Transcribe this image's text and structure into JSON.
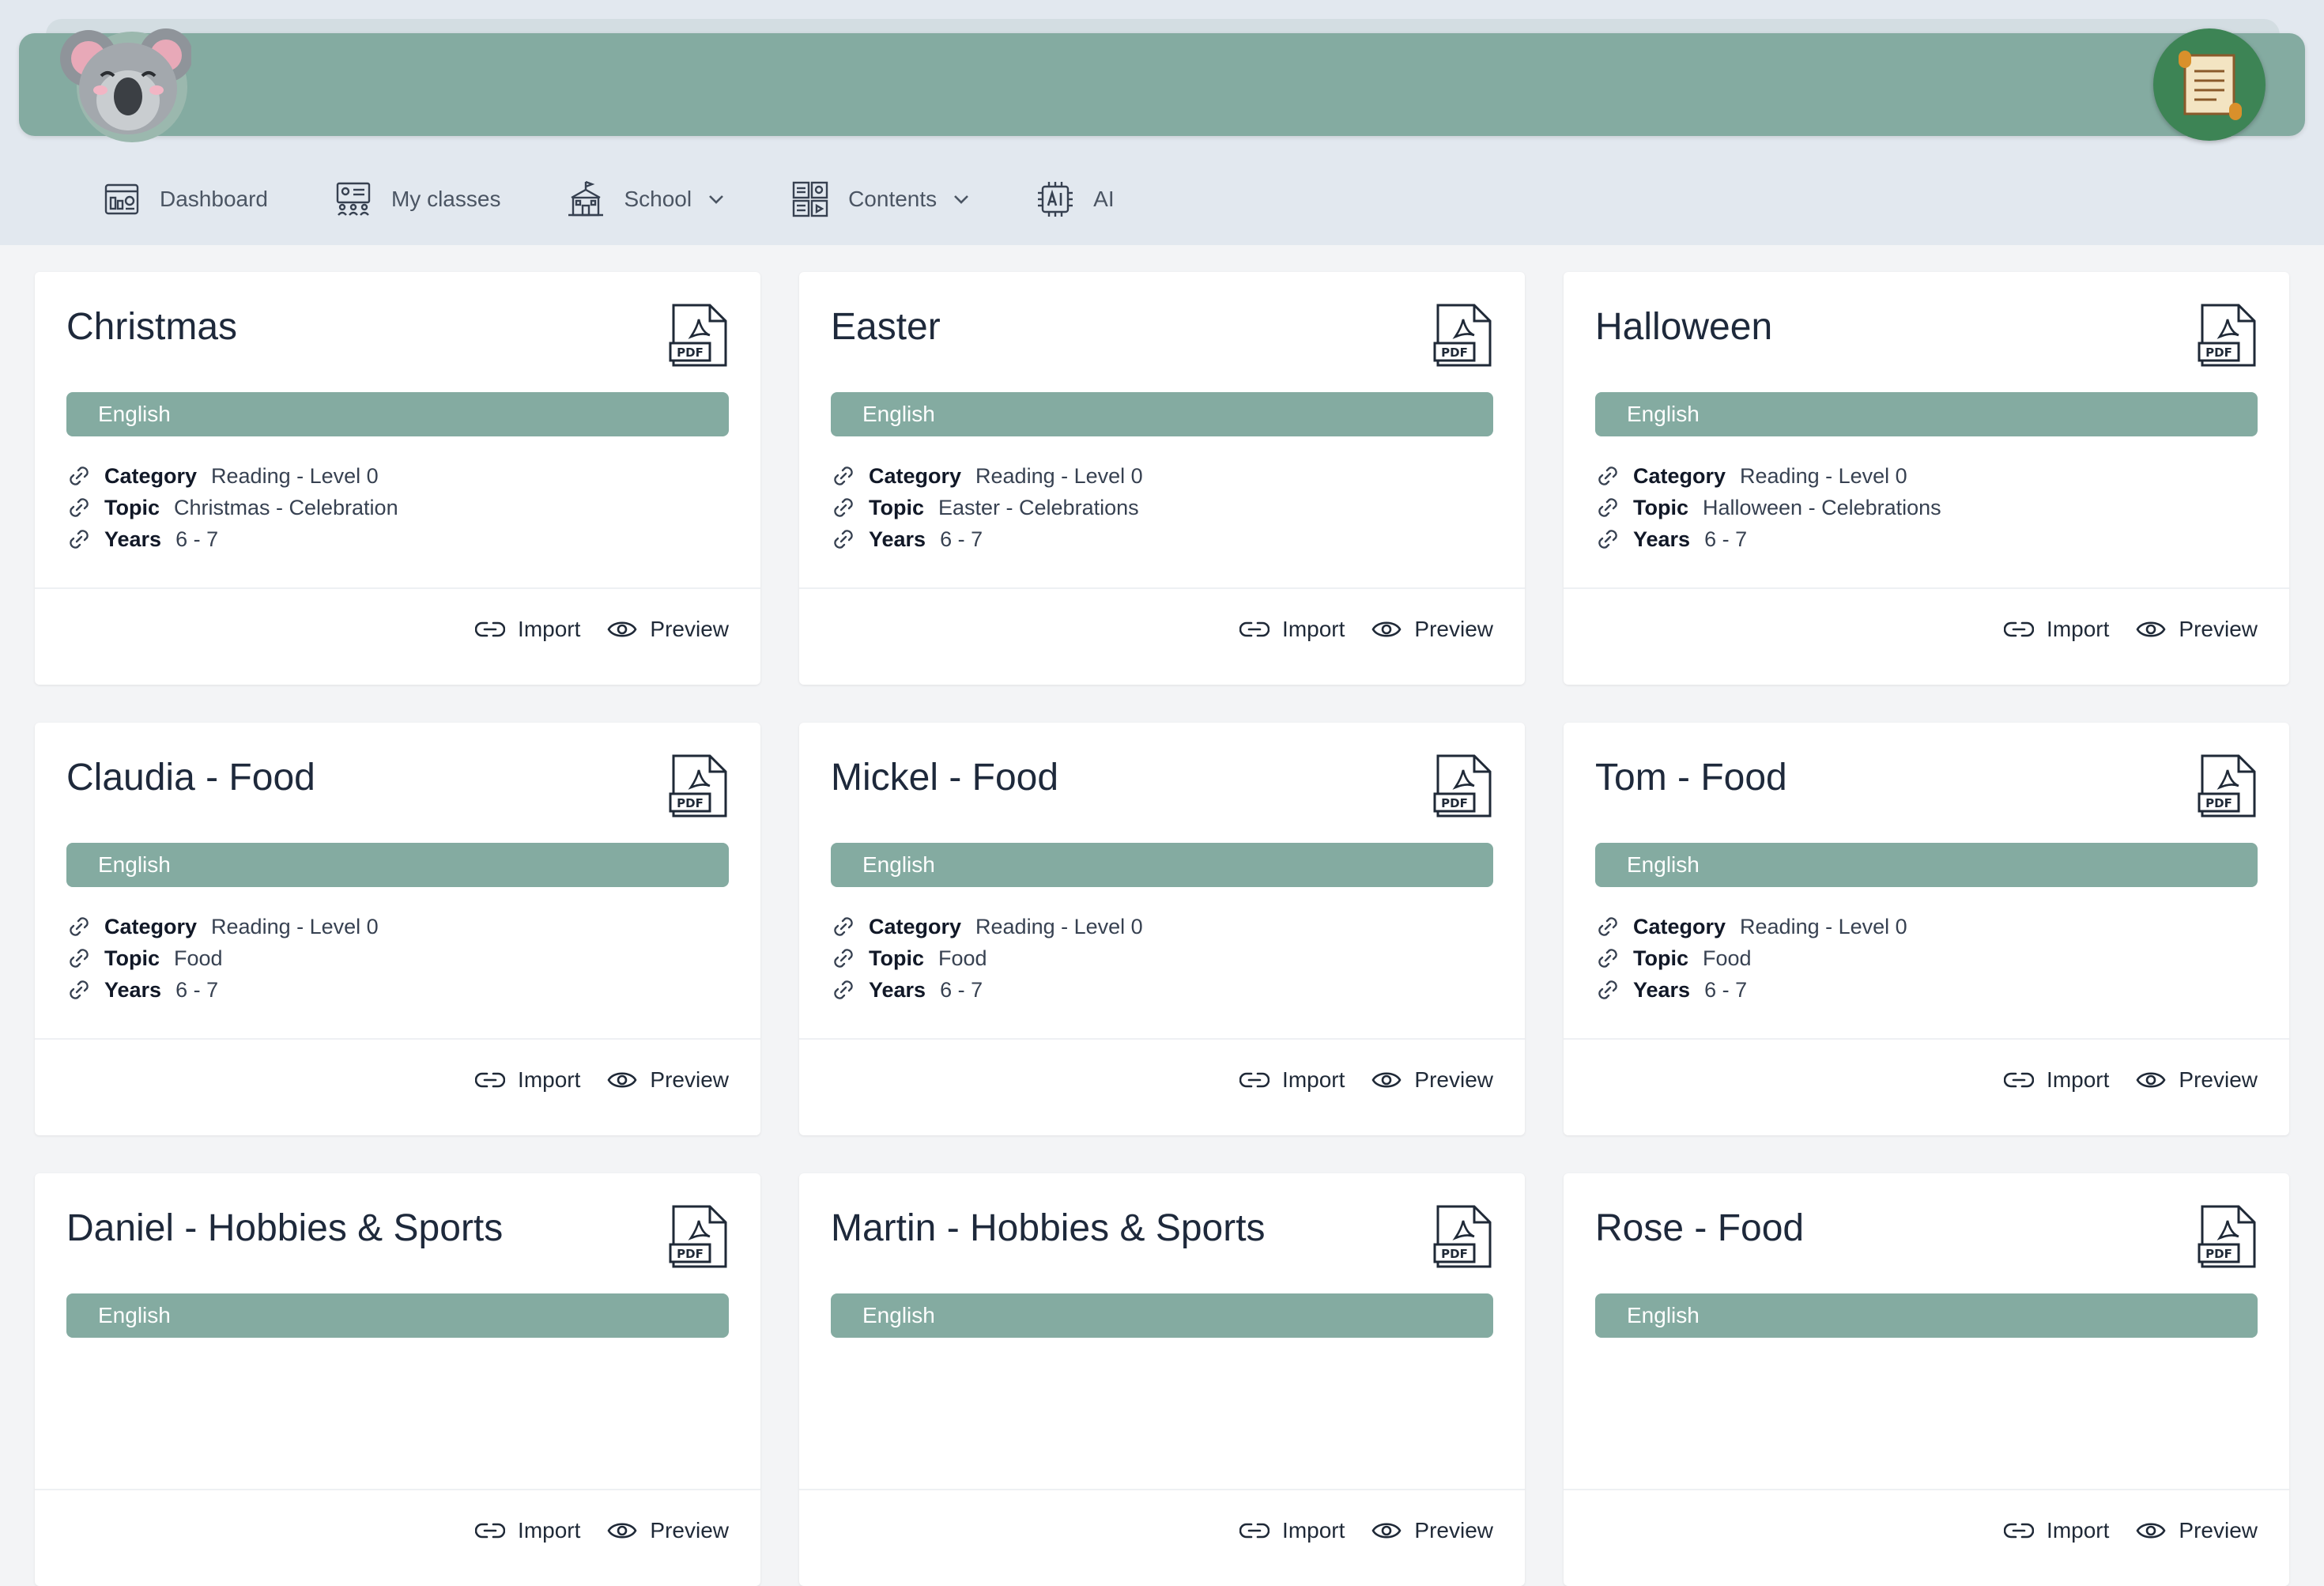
{
  "nav": {
    "items": [
      {
        "label": "Dashboard",
        "icon": "dashboard-icon",
        "dropdown": false
      },
      {
        "label": "My classes",
        "icon": "classroom-icon",
        "dropdown": false
      },
      {
        "label": "School",
        "icon": "school-icon",
        "dropdown": true
      },
      {
        "label": "Contents",
        "icon": "contents-icon",
        "dropdown": true
      },
      {
        "label": "AI",
        "icon": "ai-chip-icon",
        "dropdown": false
      }
    ]
  },
  "colors": {
    "accent": "#84aba1",
    "scroll_button": "#3d8455"
  },
  "labels": {
    "category": "Category",
    "topic": "Topic",
    "years": "Years",
    "import": "Import",
    "preview": "Preview"
  },
  "cards": [
    {
      "title": "Christmas",
      "language": "English",
      "category": "Reading - Level 0",
      "topic": "Christmas - Celebration",
      "years": "6 - 7"
    },
    {
      "title": "Easter",
      "language": "English",
      "category": "Reading - Level 0",
      "topic": "Easter - Celebrations",
      "years": "6 - 7"
    },
    {
      "title": "Halloween",
      "language": "English",
      "category": "Reading - Level 0",
      "topic": "Halloween - Celebrations",
      "years": "6 - 7"
    },
    {
      "title": "Claudia - Food",
      "language": "English",
      "category": "Reading - Level 0",
      "topic": "Food",
      "years": "6 - 7"
    },
    {
      "title": "Mickel - Food",
      "language": "English",
      "category": "Reading - Level 0",
      "topic": "Food",
      "years": "6 - 7"
    },
    {
      "title": "Tom - Food",
      "language": "English",
      "category": "Reading - Level 0",
      "topic": "Food",
      "years": "6 - 7"
    },
    {
      "title": "Daniel - Hobbies & Sports",
      "language": "English",
      "category": "",
      "topic": "",
      "years": ""
    },
    {
      "title": "Martin - Hobbies & Sports",
      "language": "English",
      "category": "",
      "topic": "",
      "years": ""
    },
    {
      "title": "Rose - Food",
      "language": "English",
      "category": "",
      "topic": "",
      "years": ""
    }
  ]
}
